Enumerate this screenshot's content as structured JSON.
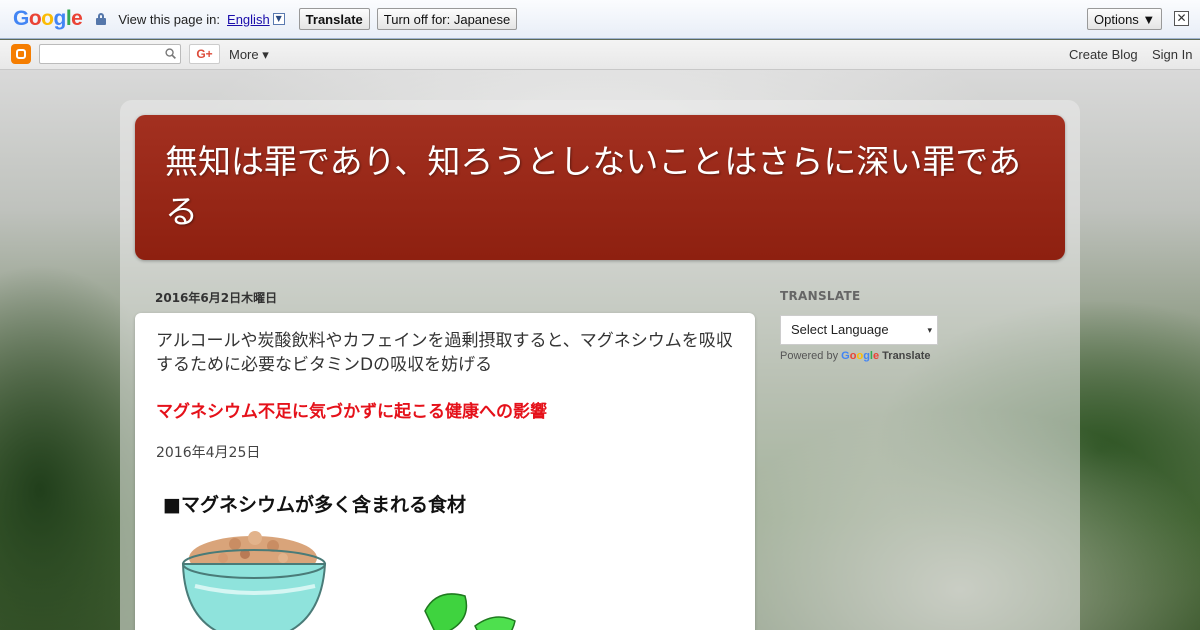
{
  "translate_bar": {
    "logo": [
      "G",
      "o",
      "o",
      "g",
      "l",
      "e"
    ],
    "view_text": "View this page in:",
    "language": "English",
    "translate_button": "Translate",
    "turn_off_button": "Turn off for: Japanese",
    "options_button": "Options ▼",
    "close": "✕"
  },
  "navbar": {
    "gplus": "G+",
    "more": "More ▾",
    "create_blog": "Create Blog",
    "sign_in": "Sign In"
  },
  "blog": {
    "title": "無知は罪であり、知ろうとしないことはさらに深い罪である"
  },
  "post": {
    "date_header": "2016年6月2日木曜日",
    "title": "アルコールや炭酸飲料やカフェインを過剰摂取すると、マグネシウムを吸収するために必要なビタミンDの吸収を妨げる",
    "link": "マグネシウム不足に気づかずに起こる健康への影響",
    "date": "2016年4月25日",
    "image_heading": "■マグネシウムが多く含まれる食材"
  },
  "sidebar": {
    "title": "TRANSLATE",
    "select_placeholder": "Select Language",
    "caret": "▾",
    "powered_by": "Powered by",
    "google": [
      "G",
      "o",
      "o",
      "g",
      "l",
      "e"
    ],
    "translate": "Translate"
  },
  "colors": {
    "header_bg": "#9a2716",
    "link_red": "#e5111a",
    "translate_bar_bg": "#e8eef7"
  }
}
